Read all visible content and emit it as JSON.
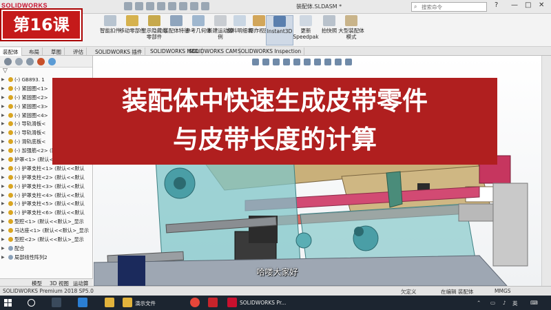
{
  "window": {
    "app_logo": "SOLIDWORKS",
    "doc_title": "装配体.SLDASM *",
    "search_placeholder": "搜索命令",
    "controls": [
      "?",
      "—",
      "□",
      "✕"
    ]
  },
  "ribbon": {
    "buttons": [
      {
        "label": "智能扣件",
        "icon": "smart-fastener-icon"
      },
      {
        "label": "移动零部件",
        "icon": "move-component-icon"
      },
      {
        "label": "显示隐藏的零部件",
        "icon": "show-hidden-icon"
      },
      {
        "label": "装配体特征",
        "icon": "assembly-feature-icon"
      },
      {
        "label": "参考几何体",
        "icon": "reference-geometry-icon"
      },
      {
        "label": "新建运动算例",
        "icon": "motion-study-icon"
      },
      {
        "label": "材料明细表",
        "icon": "bom-icon"
      },
      {
        "label": "爆炸视图",
        "icon": "exploded-view-icon"
      },
      {
        "label": "Instant3D",
        "icon": "instant3d-icon",
        "active": true
      },
      {
        "label": "更新Speedpak",
        "icon": "speedpak-icon"
      },
      {
        "label": "拍快照",
        "icon": "snapshot-icon"
      },
      {
        "label": "大型装配体模式",
        "icon": "large-assembly-icon"
      }
    ]
  },
  "command_tabs": [
    "装配体",
    "布局",
    "草图",
    "评估",
    "SOLIDWORKS 插件",
    "SOLIDWORKS MBD",
    "SOLIDWORKS CAM",
    "SOLIDWORKS Inspection"
  ],
  "feature_tree": {
    "items": [
      "(-) GB893. 1",
      "(-) 紧固圈<1>",
      "(-) 紧固圈<2>",
      "(-) 紧固圈<3>",
      "(-) 紧固圈<4>",
      "(-) 导轨滑板<",
      "(-) 导轨滑板<",
      "(-) 滑轨底板<",
      "(-) 加强筋<2> (默认<<默认>",
      "护罩<1> (默认<<默认>_显示",
      "(-) 护罩支柱<1> (默认<<默认",
      "(-) 护罩支柱<2> (默认<<默认",
      "(-) 护罩支柱<3> (默认<<默认",
      "(-) 护罩支柱<4> (默认<<默认",
      "(-) 护罩支柱<5> (默认<<默认",
      "(-) 护罩支柱<6> (默认<<默认",
      "型腔<1> (默认<<默认>_显示",
      "马达座<1> (默认<<默认>_显示",
      "型腔<2> (默认<<默认>_显示",
      "配合",
      "局部线性阵列2"
    ],
    "bottom_tabs": [
      "模型",
      "3D 视图",
      "运动算例 1"
    ]
  },
  "overlay": {
    "lesson_badge": "第16课",
    "title_line1": "装配体中快速生成皮带零件",
    "title_line2": "与皮带长度的计算",
    "subtitle": "哈喽大家好"
  },
  "statusbar": {
    "left": "SOLIDWORKS Premium 2018 SP5.0",
    "state": "欠定义",
    "editing": "在编辑 装配体",
    "units": "MMGS"
  },
  "taskbar": {
    "apps": [
      {
        "label": "",
        "icon": "search-icon"
      },
      {
        "label": "",
        "icon": "task-view-icon"
      },
      {
        "label": "",
        "icon": "ie-icon"
      },
      {
        "label": "",
        "icon": "folder-icon"
      },
      {
        "label": "演示文件",
        "icon": "folder-icon"
      },
      {
        "label": "",
        "icon": "chrome-icon"
      },
      {
        "label": "",
        "icon": "media-icon"
      },
      {
        "label": "SOLIDWORKS Pr...",
        "icon": "solidworks-icon"
      }
    ],
    "ime": "英"
  },
  "colors": {
    "title_red": "#b01f1f",
    "badge_red": "#c51a1a",
    "taskbar": "#1c2530",
    "model_teal": "#7fc6c8",
    "model_tan": "#c9b07a",
    "model_pink": "#d24a73"
  }
}
